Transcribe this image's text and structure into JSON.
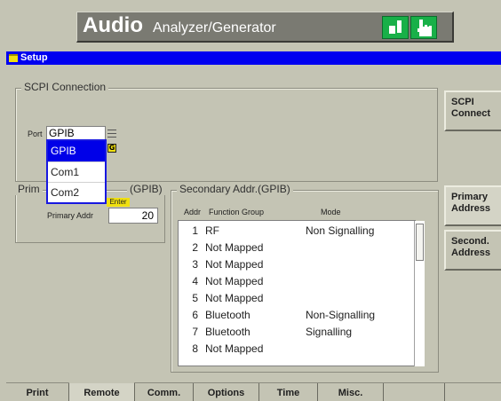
{
  "header": {
    "title_main": "Audio",
    "title_sub": "Analyzer/Generator",
    "icons": [
      "remote-status-icon",
      "touch-hand-icon"
    ]
  },
  "setup_bar": {
    "title": "Setup"
  },
  "scpi_connection": {
    "legend": "SCPI Connection",
    "port_label": "Port",
    "port_value": "GPIB",
    "port_options": [
      "GPIB",
      "Com1",
      "Com2"
    ],
    "selected_option": "GPIB",
    "g_badge": "G"
  },
  "primary_addr": {
    "legend_visible_left": "Prim",
    "legend_visible_right": "(GPIB)",
    "label": "Primary Addr",
    "value": "20",
    "enter_badge": "Enter"
  },
  "secondary_addr": {
    "legend": "Secondary Addr.(GPIB)",
    "col_addr": "Addr",
    "col_function": "Function Group",
    "col_mode": "Mode",
    "rows": [
      {
        "n": "1",
        "f": "RF",
        "m": "Non Signalling"
      },
      {
        "n": "2",
        "f": "Not Mapped",
        "m": ""
      },
      {
        "n": "3",
        "f": "Not Mapped",
        "m": ""
      },
      {
        "n": "4",
        "f": "Not Mapped",
        "m": ""
      },
      {
        "n": "5",
        "f": "Not Mapped",
        "m": ""
      },
      {
        "n": "6",
        "f": "Bluetooth",
        "m": "Non-Signalling"
      },
      {
        "n": "7",
        "f": "Bluetooth",
        "m": "Signalling"
      },
      {
        "n": "8",
        "f": "Not Mapped",
        "m": ""
      }
    ]
  },
  "sidebar": {
    "scpi_connect": "SCPI\nConnect",
    "primary_address": "Primary\nAddress",
    "second_address": "Second.\nAddress"
  },
  "tabs": [
    "Print",
    "Remote",
    "Comm.",
    "Options",
    "Time",
    "Misc."
  ],
  "active_tab": "Remote"
}
